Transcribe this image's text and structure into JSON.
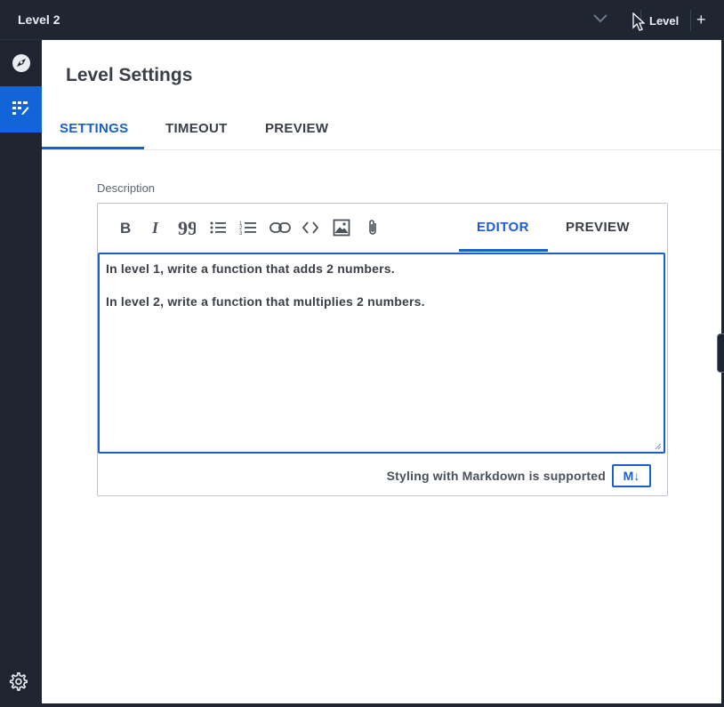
{
  "topbar": {
    "title": "Level 2",
    "level_button_label": "Level",
    "add_label": "+"
  },
  "rail": {
    "items": [
      {
        "icon": "compass-icon",
        "active": false
      },
      {
        "icon": "levels-icon",
        "active": true
      }
    ],
    "bottom_icon": "gear-icon"
  },
  "panel": {
    "title": "Level Settings",
    "tabs": [
      {
        "label": "SETTINGS",
        "active": true
      },
      {
        "label": "TIMEOUT",
        "active": false
      },
      {
        "label": "PREVIEW",
        "active": false
      }
    ],
    "description_label": "Description",
    "editor": {
      "toolbar_icons": [
        "bold-icon",
        "italic-icon",
        "quote-icon",
        "bullet-list-icon",
        "numbered-list-icon",
        "link-icon",
        "code-icon",
        "image-icon",
        "attachment-icon"
      ],
      "tabs": [
        {
          "label": "EDITOR",
          "active": true
        },
        {
          "label": "PREVIEW",
          "active": false
        }
      ],
      "lines": [
        "In level 1, write a function that adds 2 numbers.",
        "In level 2, write a function that multiplies 2 numbers."
      ],
      "footer_note": "Styling with Markdown is supported",
      "markdown_badge": "M↓"
    }
  },
  "colors": {
    "accent": "#1b5fcf",
    "sidebar_bg": "#1e2430",
    "active_rail": "#1165d8"
  }
}
